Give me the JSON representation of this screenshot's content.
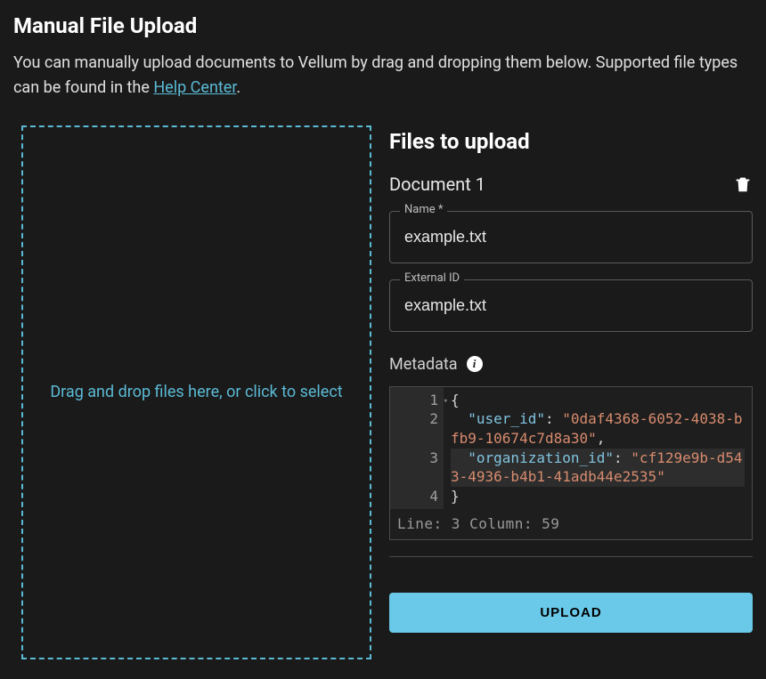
{
  "header": {
    "title": "Manual File Upload",
    "description_pre": "You can manually upload documents to Vellum by drag and dropping them below. Supported file types can be found in the  ",
    "help_link_text": "Help Center",
    "description_post": "."
  },
  "dropzone": {
    "text": "Drag and drop files here, or click to select"
  },
  "files_section": {
    "heading": "Files to upload"
  },
  "document": {
    "title": "Document 1",
    "name_label": "Name *",
    "name_value": "example.txt",
    "external_id_label": "External ID",
    "external_id_value": "example.txt",
    "metadata_label": "Metadata"
  },
  "code": {
    "gutter": {
      "l1": "1",
      "l2": "2",
      "l3": "3",
      "l4": "4"
    },
    "line1_open": "{",
    "line2_key": "\"user_id\"",
    "line2_val": "\"0daf4368-6052-4038-bfb9-10674c7d8a30\"",
    "line3_key": "\"organization_id\"",
    "line3_val": "\"cf129e9b-d543-4936-b4b1-41adb44e2535\"",
    "line4_close": "}",
    "status": "Line: 3  Column: 59"
  },
  "upload": {
    "label": "UPLOAD"
  }
}
